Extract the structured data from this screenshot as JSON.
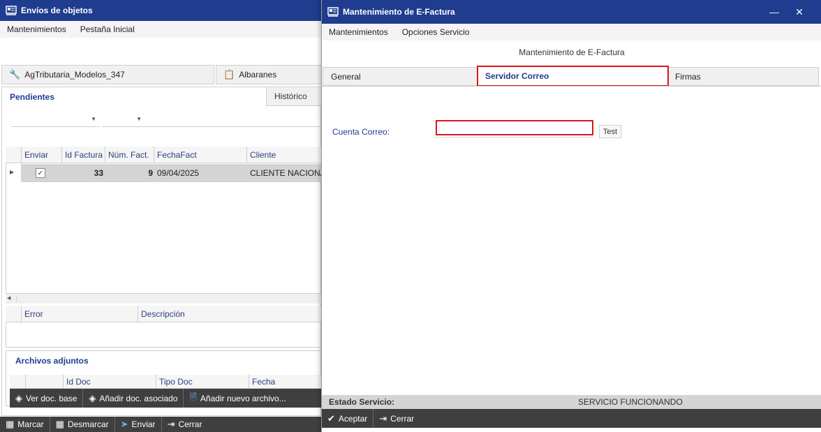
{
  "bg": {
    "title": "Envíos de objetos",
    "menu": [
      "Mantenimientos",
      "Pestaña Inicial"
    ],
    "doc_tabs": [
      {
        "icon": "wrench-icon",
        "label": "AgTributaria_Modelos_347"
      },
      {
        "icon": "clipboard-icon",
        "label": "Albaranes"
      }
    ],
    "subtabs": [
      "Pendientes",
      "Histórico"
    ],
    "grid": {
      "headers": [
        "Enviar",
        "Id Factura",
        "Núm. Fact.",
        "FechaFact",
        "Cliente"
      ],
      "rows": [
        {
          "enviar_checked": true,
          "id_factura": "33",
          "num_fact": "9",
          "fecha": "09/04/2025",
          "cliente": "CLIENTE NACIONAL"
        }
      ]
    },
    "error_grid": {
      "headers": [
        "Error",
        "Descripción"
      ]
    },
    "adjuntos": {
      "title": "Archivos adjuntos",
      "headers": [
        "Id Doc",
        "Tipo Doc",
        "Fecha"
      ],
      "buttons": [
        "Ver doc. base",
        "Añadir doc. asociado",
        "Añadir nuevo archivo..."
      ]
    },
    "bottom_toolbar": [
      "Marcar",
      "Desmarcar",
      "Enviar",
      "Cerrar"
    ]
  },
  "modal": {
    "title": "Mantenimiento de E-Factura",
    "menu": [
      "Mantenimientos",
      "Opciones Servicio"
    ],
    "heading": "Mantenimiento de E-Factura",
    "tabs": [
      "General",
      "Servidor Correo",
      "Firmas"
    ],
    "active_tab": "Servidor Correo",
    "cuenta_label": "Cuenta Correo:",
    "cuenta_value": "",
    "test_button": "Test",
    "status_label": "Estado Servicio:",
    "status_value": "SERVICIO FUNCIONANDO",
    "toolbar": [
      "Aceptar",
      "Cerrar"
    ],
    "accent": "#1f3c8f",
    "highlight": "#d9141e"
  }
}
